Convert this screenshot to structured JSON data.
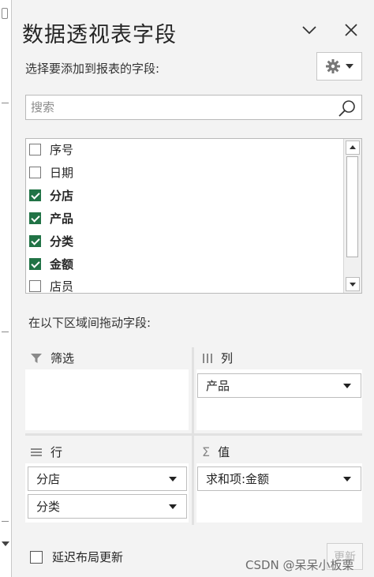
{
  "pane": {
    "title": "数据透视表字段",
    "choose_label": "选择要添加到报表的字段:",
    "search_placeholder": "搜索",
    "drag_label": "在以下区域间拖动字段:"
  },
  "fields": [
    {
      "label": "序号",
      "checked": false
    },
    {
      "label": "日期",
      "checked": false
    },
    {
      "label": "分店",
      "checked": true
    },
    {
      "label": "产品",
      "checked": true
    },
    {
      "label": "分类",
      "checked": true
    },
    {
      "label": "金额",
      "checked": true
    },
    {
      "label": "店员",
      "checked": false
    }
  ],
  "areas": {
    "filters": {
      "label": "筛选",
      "items": []
    },
    "columns": {
      "label": "列",
      "items": [
        "产品"
      ]
    },
    "rows": {
      "label": "行",
      "items": [
        "分店",
        "分类"
      ]
    },
    "values": {
      "label": "值",
      "items": [
        "求和项:金额"
      ]
    }
  },
  "footer": {
    "defer_label": "延迟布局更新",
    "update_label": "更新"
  },
  "watermark": "CSDN @呆呆小板栗",
  "colors": {
    "checkbox_checked": "#217346"
  },
  "icons": [
    "chevron-down-icon",
    "close-icon",
    "gear-icon",
    "search-icon",
    "filter-icon",
    "columns-icon",
    "rows-icon",
    "sigma-icon"
  ]
}
